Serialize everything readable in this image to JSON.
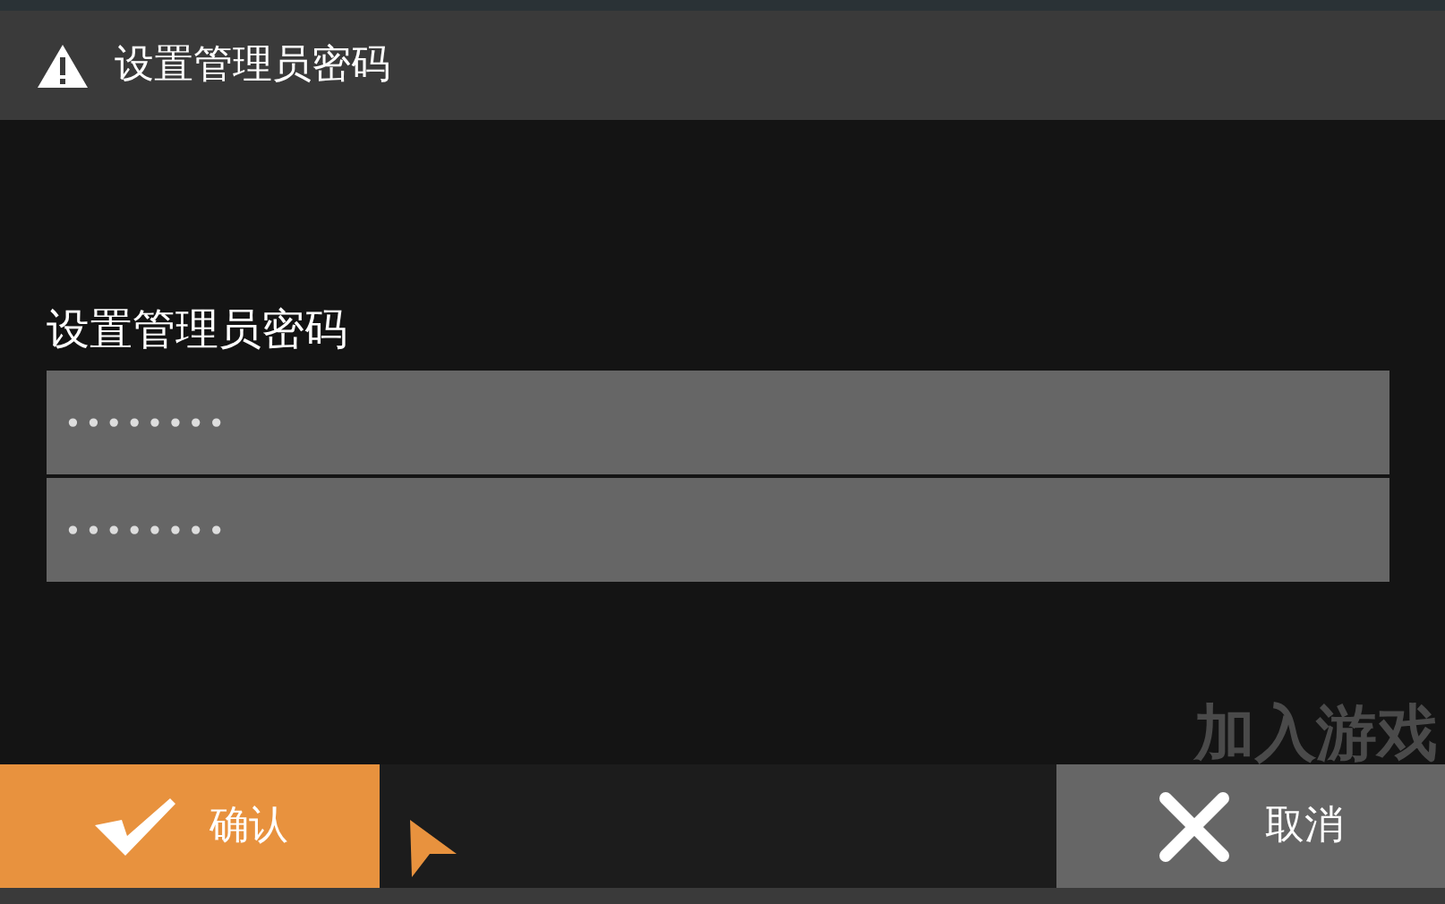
{
  "dialog": {
    "title": "设置管理员密码"
  },
  "background_text": "加入游戏",
  "form": {
    "label": "设置管理员密码",
    "fields": [
      {
        "value": "••••••••"
      },
      {
        "value": "••••••••"
      }
    ]
  },
  "buttons": [
    {
      "kind": "confirm",
      "label": "确认"
    },
    {
      "kind": "cancel",
      "label": "取消"
    }
  ]
}
